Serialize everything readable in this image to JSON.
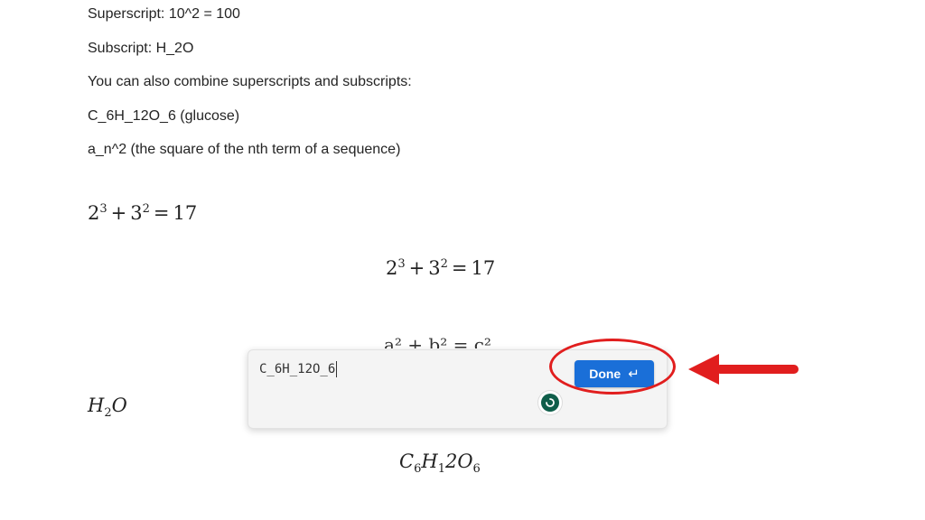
{
  "text_lines": [
    "Superscript: 10^2 = 100",
    "Subscript: H_2O",
    "You can also combine superscripts and subscripts:",
    "C_6H_12O_6 (glucose)",
    "a_n^2 (the square of the nth term of a sequence)"
  ],
  "eq1": {
    "a": "2",
    "a_exp": "3",
    "plus": "+",
    "b": "3",
    "b_exp": "2",
    "eq": "=",
    "result": "17"
  },
  "eq2": {
    "a": "2",
    "a_exp": "3",
    "plus": "+",
    "b": "3",
    "b_exp": "2",
    "eq": "=",
    "result": "17"
  },
  "eq3_partial": "a² + b² = c²",
  "water": {
    "h": "H",
    "sub": "2",
    "o": "O"
  },
  "glucose": {
    "c": "C",
    "c_sub": "6",
    "h": "H",
    "h_sub": "1",
    "rest": "2O",
    "o_sub": "6"
  },
  "editor": {
    "input_value": "C_6H_12O_6",
    "done_label": "Done",
    "enter_icon": "↵"
  },
  "annotation": {
    "color": "#e11e1e"
  },
  "colors": {
    "button": "#1a6fd8",
    "spinner": "#0f5e4a"
  }
}
